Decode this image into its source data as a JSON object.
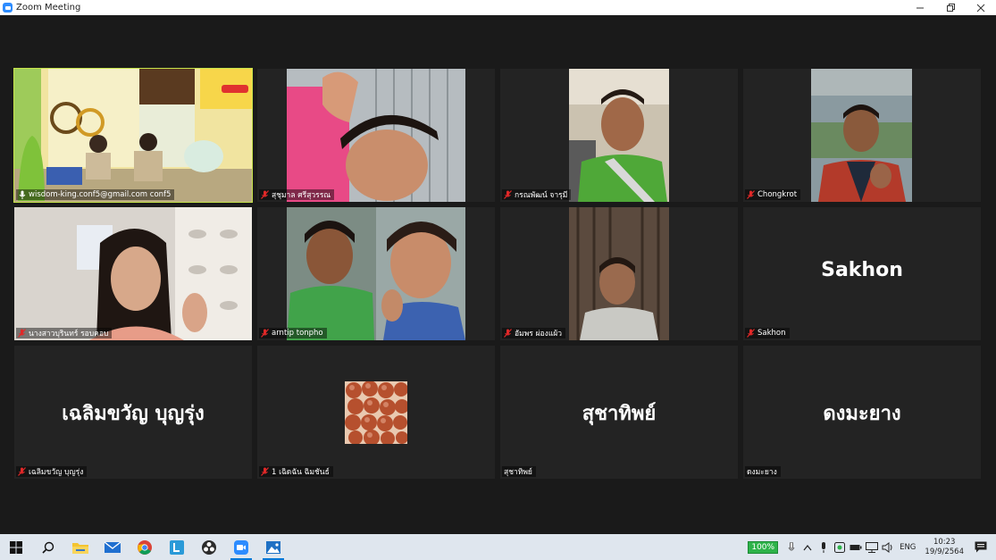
{
  "window": {
    "title": "Zoom Meeting"
  },
  "participants": [
    {
      "name": "wisdom-king.conf5@gmail.com conf5",
      "muted": false,
      "video": true,
      "active_speaker": true
    },
    {
      "name": "สุชุมาล ศรีสุวรรณ",
      "muted": true,
      "video": true
    },
    {
      "name": "กรณพัฒน์ จารุมี",
      "muted": true,
      "video": true
    },
    {
      "name": "Chongkrot",
      "muted": true,
      "video": true
    },
    {
      "name": "นางสาวบุรินทร์ รอบคอบ",
      "muted": true,
      "video": true
    },
    {
      "name": "arntip  tonpho",
      "muted": true,
      "video": true
    },
    {
      "name": "อัมพร ผ่องแผ้ว",
      "muted": true,
      "video": true
    },
    {
      "name": "Sakhon",
      "muted": true,
      "video": false,
      "display_name": "Sakhon"
    },
    {
      "name": "เฉลิมขวัญ บุญรุ่ง",
      "muted": true,
      "video": false,
      "display_name": "เฉลิมขวัญ บุญรุ่ง"
    },
    {
      "name": "1 เฉิดฉัน ฉิมชันธ์",
      "muted": true,
      "video": false,
      "avatar": "photo"
    },
    {
      "name": "สุชาทิพย์",
      "muted": false,
      "video": false,
      "display_name": "สุชาทิพย์"
    },
    {
      "name": "ดงมะยาง",
      "muted": false,
      "video": false,
      "display_name": "ดงมะยาง"
    }
  ],
  "taskbar": {
    "zoom_level": "100%",
    "language": "ENG",
    "time": "10:23",
    "date": "19/9/2564"
  },
  "colors": {
    "active_speaker": "#c6e34a",
    "muted_mic": "#e02828",
    "zoom_blue": "#2d8cff"
  }
}
